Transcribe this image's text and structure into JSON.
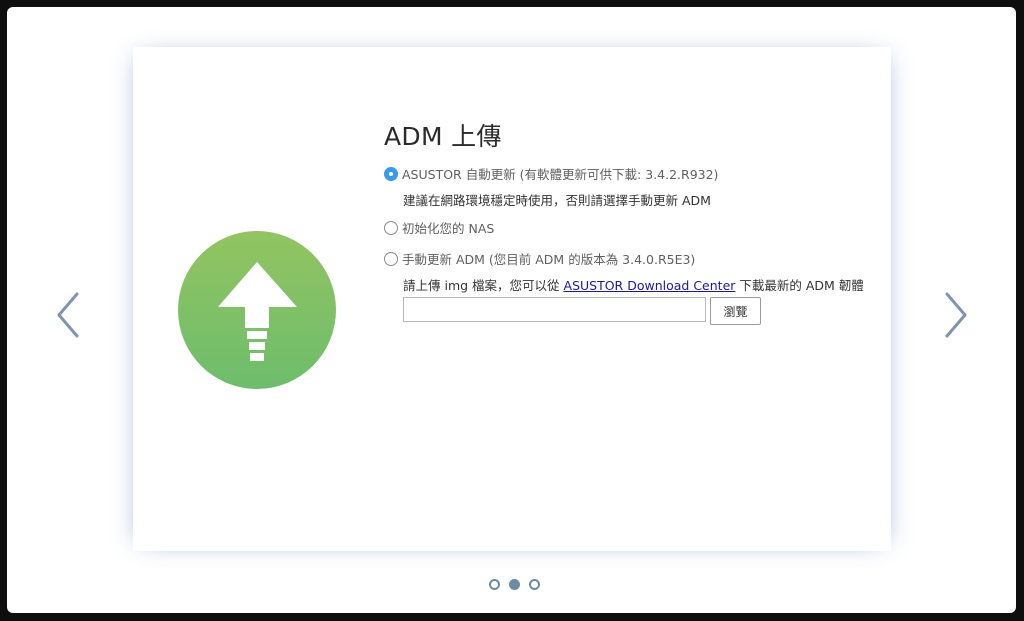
{
  "dialog": {
    "title": "ADM 上傳"
  },
  "options": {
    "auto_update": {
      "label": "ASUSTOR 自動更新 (有軟體更新可供下載: 3.4.2.R932)",
      "selected": true,
      "note": "建議在網路環境穩定時使用，否則請選擇手動更新 ADM"
    },
    "initialize": {
      "label": "初始化您的 NAS",
      "selected": false
    },
    "manual_update": {
      "label": "手動更新 ADM (您目前 ADM 的版本為 3.4.0.R5E3)",
      "selected": false,
      "note_prefix": "請上傳 img 檔案，您可以從 ",
      "note_link": "ASUSTOR Download Center",
      "note_suffix": " 下載最新的 ADM 韌體"
    }
  },
  "file_upload": {
    "value": "",
    "browse_label": "瀏覽"
  },
  "pagination": {
    "total": 3,
    "current": 2
  },
  "icons": {
    "prev": "chevron-left-icon",
    "next": "chevron-right-icon",
    "upload": "upload-arrow-icon"
  },
  "colors": {
    "accent": "#3c9be8",
    "badge_top": "#93c461",
    "badge_bottom": "#6dbd6c",
    "nav_arrow": "#7f93b3",
    "dot": "#6d8ba3",
    "link": "#1a1a9a"
  }
}
